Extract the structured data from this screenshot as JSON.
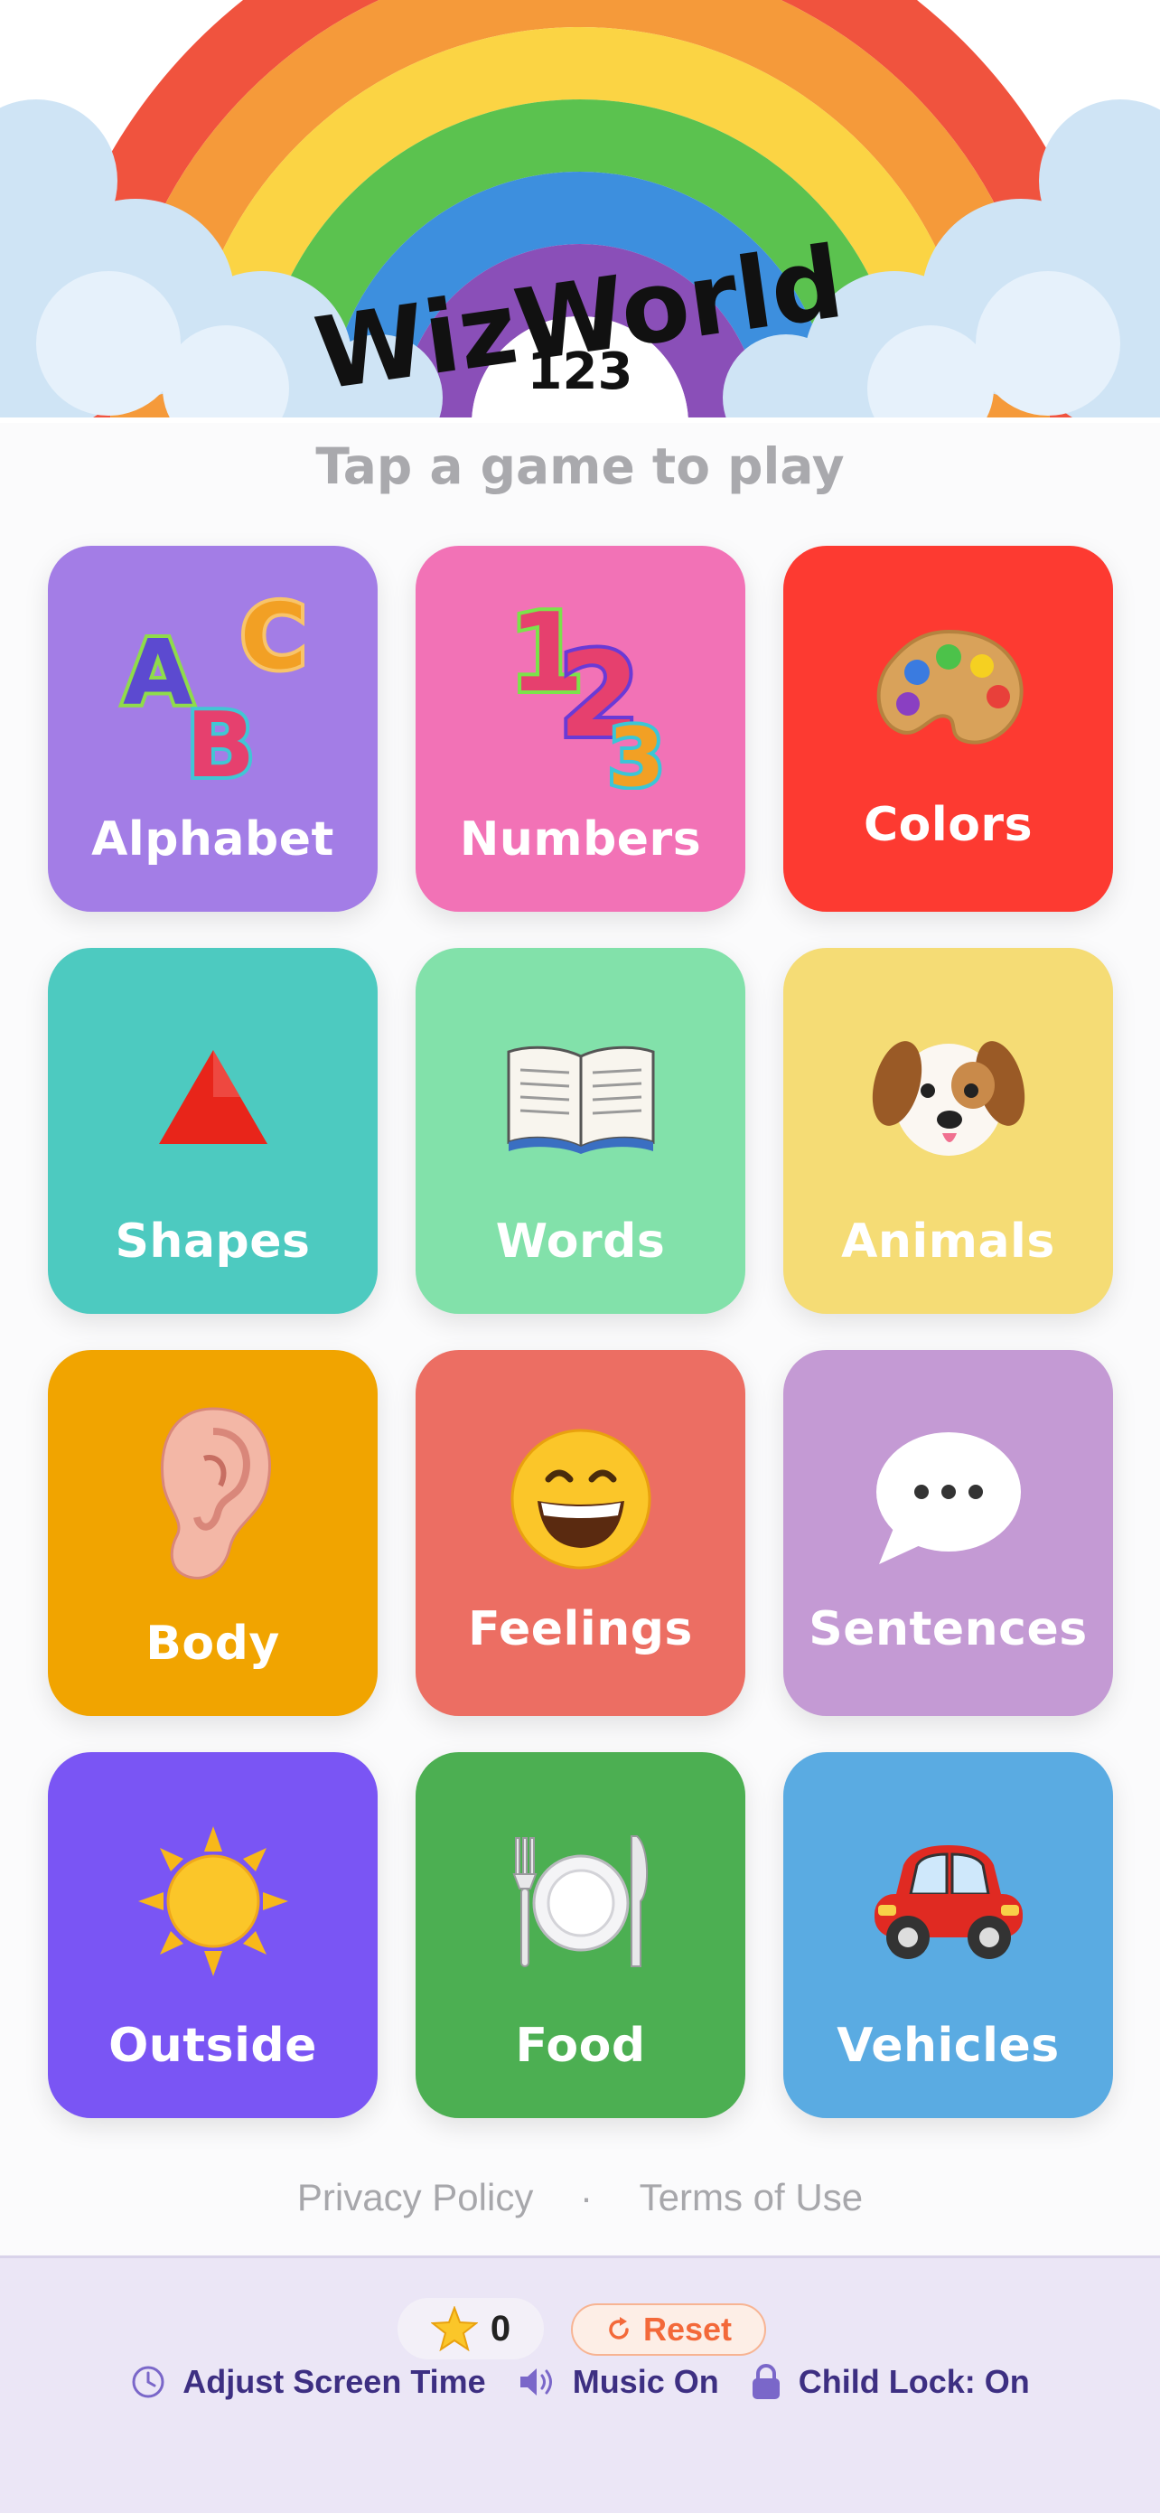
{
  "header": {
    "logo_word": "WizWorld",
    "logo_number": "123"
  },
  "subtitle": "Tap a game to play",
  "games": [
    {
      "label": "Alphabet",
      "color": "#a37de6",
      "icon": "abc-letters-icon"
    },
    {
      "label": "Numbers",
      "color": "#f272b6",
      "icon": "numbers-123-icon"
    },
    {
      "label": "Colors",
      "color": "#fd3a31",
      "icon": "palette-icon"
    },
    {
      "label": "Shapes",
      "color": "#4dcac0",
      "icon": "triangle-icon"
    },
    {
      "label": "Words",
      "color": "#82e1aa",
      "icon": "book-icon"
    },
    {
      "label": "Animals",
      "color": "#f5dc75",
      "icon": "dog-icon"
    },
    {
      "label": "Body",
      "color": "#f1a400",
      "icon": "ear-icon"
    },
    {
      "label": "Feelings",
      "color": "#ec6e63",
      "icon": "smiley-icon"
    },
    {
      "label": "Sentences",
      "color": "#c49ad4",
      "icon": "speech-bubble-icon"
    },
    {
      "label": "Outside",
      "color": "#7a55f4",
      "icon": "sun-icon"
    },
    {
      "label": "Food",
      "color": "#4caf52",
      "icon": "plate-icon"
    },
    {
      "label": "Vehicles",
      "color": "#5aabe2",
      "icon": "car-icon"
    }
  ],
  "links": {
    "privacy": "Privacy Policy",
    "separator": "·",
    "terms": "Terms of Use"
  },
  "footer": {
    "stars_count": "0",
    "reset_label": "Reset",
    "screen_time_label": "Adjust Screen Time",
    "music_label": "Music On",
    "child_lock_label": "Child Lock: On"
  }
}
